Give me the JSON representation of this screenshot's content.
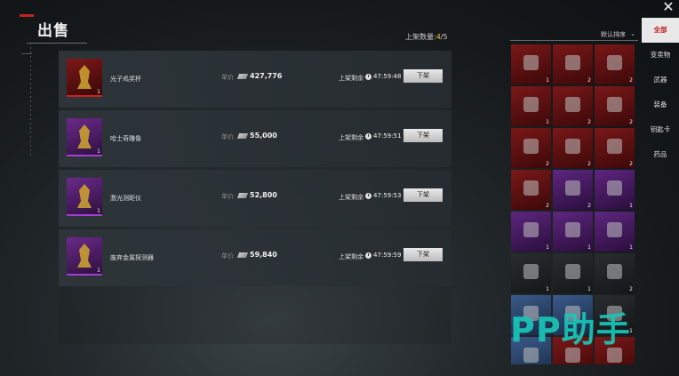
{
  "header": {
    "title": "出售",
    "capacity_label": "上架数量:",
    "capacity_count": "4",
    "capacity_total": "/5"
  },
  "listings": [
    {
      "name": "光子鸡奖杯",
      "price_label": "单价",
      "price": "427,776",
      "time_label": "上架剩余",
      "time": "47:59:48",
      "delist_label": "下架",
      "qty": "1",
      "rarity": "red"
    },
    {
      "name": "哈士奇雕像",
      "price_label": "单价",
      "price": "55,000",
      "time_label": "上架剩余",
      "time": "47:59:51",
      "delist_label": "下架",
      "qty": "1",
      "rarity": "purple"
    },
    {
      "name": "激光测距仪",
      "price_label": "单价",
      "price": "52,800",
      "time_label": "上架剩余",
      "time": "47:59:53",
      "delist_label": "下架",
      "qty": "1",
      "rarity": "purple"
    },
    {
      "name": "废弃金属探测器",
      "price_label": "单价",
      "price": "59,840",
      "time_label": "上架剩余",
      "time": "47:59:59",
      "delist_label": "下架",
      "qty": "1",
      "rarity": "purple"
    }
  ],
  "inventory": {
    "sort_label": "默认排序",
    "items": [
      {
        "rarity": "red",
        "qty": "1",
        "icon": "device-icon"
      },
      {
        "rarity": "red",
        "qty": "2",
        "icon": "blue-card-icon"
      },
      {
        "rarity": "red",
        "qty": "2",
        "icon": "documents-icon"
      },
      {
        "rarity": "red",
        "qty": "1",
        "icon": "graphics-card-icon"
      },
      {
        "rarity": "red",
        "qty": "2",
        "icon": "gold-bar-icon"
      },
      {
        "rarity": "red",
        "qty": "2",
        "icon": "trophy-icon"
      },
      {
        "rarity": "red",
        "qty": "2",
        "icon": "gold-leaf-icon"
      },
      {
        "rarity": "red",
        "qty": "2",
        "icon": "bracelet-icon"
      },
      {
        "rarity": "red",
        "qty": "2",
        "icon": "shell-icon"
      },
      {
        "rarity": "red",
        "qty": "2",
        "icon": "necklace-icon"
      },
      {
        "rarity": "purple",
        "qty": "2",
        "icon": "solar-panel-icon"
      },
      {
        "rarity": "purple",
        "qty": "1",
        "icon": "radio-icon"
      },
      {
        "rarity": "purple",
        "qty": "1",
        "icon": "dog-statue-icon"
      },
      {
        "rarity": "purple",
        "qty": "1",
        "icon": "bottle-icon"
      },
      {
        "rarity": "purple",
        "qty": "1",
        "icon": "fan-icon"
      },
      {
        "rarity": "dark",
        "qty": "1",
        "icon": "box-icon"
      },
      {
        "rarity": "dark",
        "qty": "1",
        "icon": "safe-icon"
      },
      {
        "rarity": "dark",
        "qty": "2",
        "icon": "tools-icon"
      },
      {
        "rarity": "blue",
        "qty": "1",
        "icon": "coil-icon"
      },
      {
        "rarity": "blue",
        "qty": "",
        "icon": "wire-icon"
      },
      {
        "rarity": "dark",
        "qty": "1",
        "icon": "badge-icon"
      },
      {
        "rarity": "blue",
        "qty": "",
        "icon": "cards-icon"
      },
      {
        "rarity": "red",
        "qty": "",
        "icon": "chip-icon"
      },
      {
        "rarity": "red",
        "qty": "",
        "icon": "flask-icon"
      }
    ]
  },
  "tabs": [
    {
      "label": "全部",
      "active": true
    },
    {
      "label": "变卖物",
      "active": false
    },
    {
      "label": "武器",
      "active": false
    },
    {
      "label": "装备",
      "active": false
    },
    {
      "label": "钥匙卡",
      "active": false
    },
    {
      "label": "药品",
      "active": false
    }
  ],
  "watermark": "PP助手",
  "colors": {
    "accent_red": "#c01818",
    "rarity_red": "#7a1818",
    "rarity_purple": "#5e2680",
    "watermark": "#19c6b8"
  }
}
